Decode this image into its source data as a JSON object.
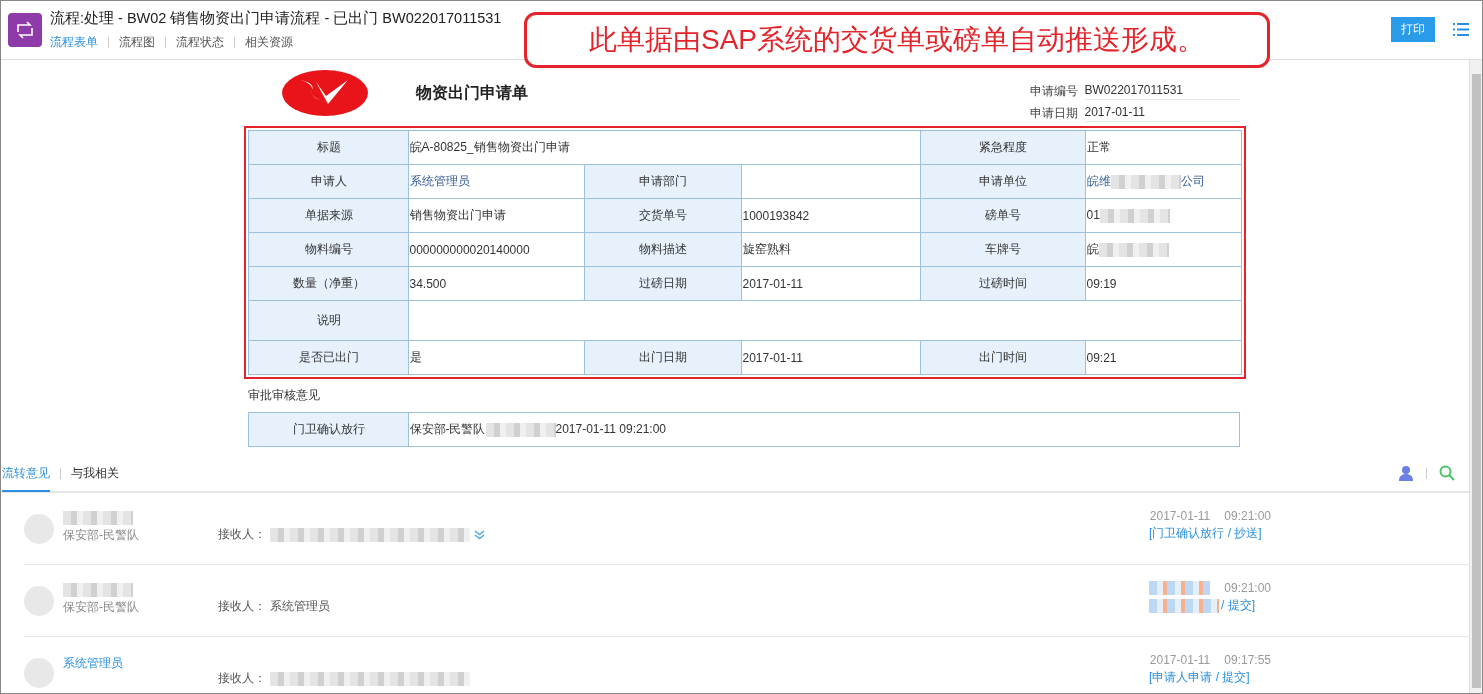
{
  "header": {
    "title": "流程:处理 - BW02 销售物资出门申请流程 - 已出门 BW022017011531",
    "tabs": [
      {
        "label": "流程表单",
        "selected": true
      },
      {
        "label": "流程图",
        "selected": false
      },
      {
        "label": "流程状态",
        "selected": false
      },
      {
        "label": "相关资源",
        "selected": false
      }
    ],
    "print_button": "打印"
  },
  "callout": "此单据由SAP系统的交货单或磅单自动推送形成。",
  "form": {
    "title": "物资出门申请单",
    "meta": [
      {
        "label": "申请编号",
        "value": "BW022017011531"
      },
      {
        "label": "申请日期",
        "value": "2017-01-11"
      }
    ],
    "rows": [
      [
        {
          "kind": "label",
          "text": "标题"
        },
        {
          "kind": "value",
          "colspan": 3,
          "value": [
            {
              "kind": "text",
              "text": "皖A-80825_销售物资出门申请"
            }
          ]
        },
        {
          "kind": "label",
          "text": "紧急程度"
        },
        {
          "kind": "value",
          "value": [
            {
              "kind": "text",
              "text": "正常"
            }
          ]
        }
      ],
      [
        {
          "kind": "label",
          "text": "申请人"
        },
        {
          "kind": "value",
          "value": [
            {
              "kind": "link",
              "text": "系统管理员"
            }
          ]
        },
        {
          "kind": "label",
          "text": "申请部门"
        },
        {
          "kind": "value"
        },
        {
          "kind": "label",
          "text": "申请单位"
        },
        {
          "kind": "value",
          "value": [
            {
              "kind": "link",
              "text": "皖维"
            },
            {
              "kind": "blur"
            },
            {
              "kind": "link",
              "text": "公司"
            }
          ]
        }
      ],
      [
        {
          "kind": "label",
          "text": "单据来源"
        },
        {
          "kind": "value",
          "value": [
            {
              "kind": "text",
              "text": "销售物资出门申请"
            }
          ]
        },
        {
          "kind": "label",
          "text": "交货单号"
        },
        {
          "kind": "value",
          "value": [
            {
              "kind": "text",
              "text": "1000193842"
            }
          ]
        },
        {
          "kind": "label",
          "text": "磅单号"
        },
        {
          "kind": "value",
          "value": [
            {
              "kind": "text",
              "text": "01"
            },
            {
              "kind": "blur"
            }
          ]
        }
      ],
      [
        {
          "kind": "label",
          "text": "物料编号"
        },
        {
          "kind": "value",
          "value": [
            {
              "kind": "text",
              "text": "000000000020140000"
            }
          ]
        },
        {
          "kind": "label",
          "text": "物料描述"
        },
        {
          "kind": "value",
          "value": [
            {
              "kind": "text",
              "text": "旋窑熟料"
            }
          ]
        },
        {
          "kind": "label",
          "text": "车牌号"
        },
        {
          "kind": "value",
          "value": [
            {
              "kind": "text",
              "text": "皖"
            },
            {
              "kind": "blur"
            }
          ]
        }
      ],
      [
        {
          "kind": "label",
          "text": "数量（净重）"
        },
        {
          "kind": "value",
          "value": [
            {
              "kind": "text",
              "text": "34.500"
            }
          ]
        },
        {
          "kind": "label",
          "text": "过磅日期"
        },
        {
          "kind": "value",
          "value": [
            {
              "kind": "text",
              "text": "2017-01-11"
            }
          ]
        },
        {
          "kind": "label",
          "text": "过磅时间"
        },
        {
          "kind": "value",
          "value": [
            {
              "kind": "text",
              "text": "09:19"
            }
          ]
        }
      ],
      [
        {
          "kind": "label",
          "text": "说明"
        },
        {
          "kind": "value",
          "colspan": 5
        }
      ],
      [
        {
          "kind": "label",
          "text": "是否已出门"
        },
        {
          "kind": "value",
          "value": [
            {
              "kind": "text",
              "text": "是"
            }
          ]
        },
        {
          "kind": "label",
          "text": "出门日期"
        },
        {
          "kind": "value",
          "value": [
            {
              "kind": "text",
              "text": "2017-01-11"
            }
          ]
        },
        {
          "kind": "label",
          "text": "出门时间"
        },
        {
          "kind": "value",
          "value": [
            {
              "kind": "text",
              "text": "09:21"
            }
          ]
        }
      ]
    ],
    "approval_heading": "审批审核意见",
    "approvals": [
      {
        "label": "门卫确认放行",
        "value": [
          {
            "kind": "text",
            "text": "保安部-民警队"
          },
          {
            "kind": "blur"
          },
          {
            "kind": "text",
            "text": "2017-01-11 09:21:00"
          }
        ]
      }
    ]
  },
  "comments_tabs": [
    {
      "label": "流转意见",
      "selected": true
    },
    {
      "label": "与我相关",
      "selected": false
    }
  ],
  "comments": [
    {
      "name": [
        {
          "kind": "blur"
        }
      ],
      "dept": "保安部-民警队",
      "receiver_label": "接收人：",
      "receiver": [
        {
          "kind": "blur"
        }
      ],
      "expandable": true,
      "date": [
        {
          "kind": "text",
          "text": "2017-01-11"
        }
      ],
      "time": "09:21:00",
      "action": [
        {
          "kind": "text",
          "text": "[门卫确认放行 / 抄送]"
        }
      ]
    },
    {
      "name": [
        {
          "kind": "blur"
        }
      ],
      "dept": "保安部-民警队",
      "receiver_label": "接收人：",
      "receiver": [
        {
          "kind": "text",
          "text": "系统管理员"
        }
      ],
      "expandable": false,
      "date": [
        {
          "kind": "blur"
        }
      ],
      "time": "09:21:00",
      "action": [
        {
          "kind": "blur"
        },
        {
          "kind": "text",
          "text": "/ 提交]"
        }
      ]
    },
    {
      "name": [
        {
          "kind": "text",
          "text": "系统管理员"
        }
      ],
      "receiver_label": "接收人：",
      "receiver": [
        {
          "kind": "blur"
        }
      ],
      "expandable": false,
      "date": [
        {
          "kind": "text",
          "text": "2017-01-11"
        }
      ],
      "time": "09:17:55",
      "action": [
        {
          "kind": "text",
          "text": "[申请人申请 / 提交]"
        }
      ]
    }
  ]
}
